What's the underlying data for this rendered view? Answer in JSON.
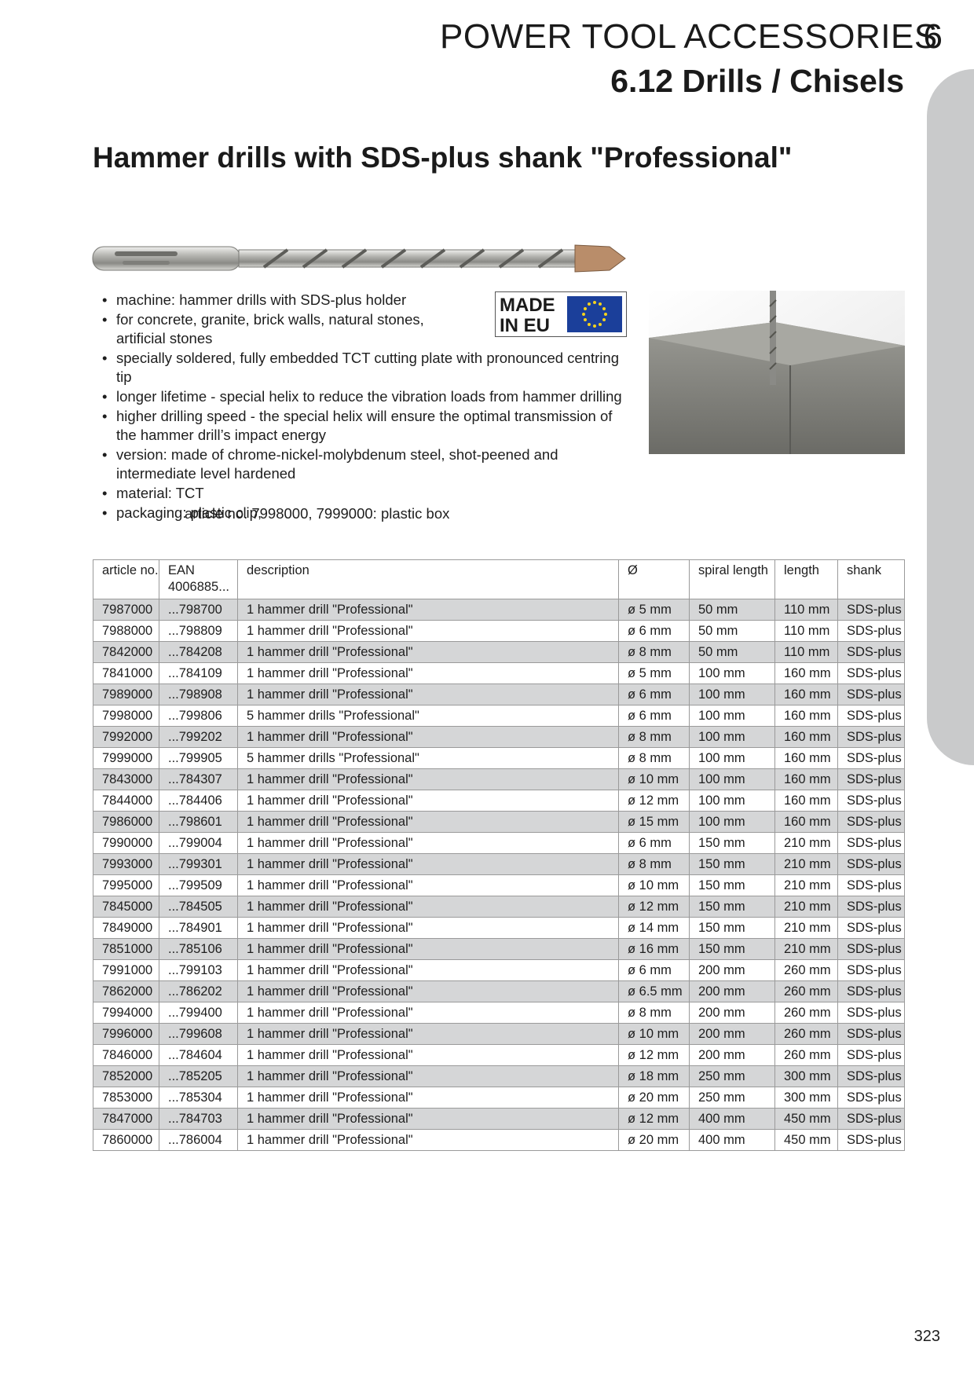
{
  "header": {
    "section_title": "POWER TOOL ACCESSORIES",
    "chapter_number": "6",
    "subsection": "6.12 Drills / Chisels"
  },
  "product": {
    "title": "Hammer drills with SDS-plus shank \"Professional\"",
    "badge": {
      "line1": "MADE",
      "line2": "IN EU"
    },
    "features": [
      "machine: hammer drills with SDS-plus holder",
      "for concrete, granite, brick walls, natural stones, artificial stones",
      "specially soldered, fully embedded TCT cutting plate with pronounced centring tip",
      "longer lifetime - special helix to reduce the vibration loads from hammer drilling",
      "higher drilling speed - the special helix will ensure the optimal transmission of the hammer drill’s impact energy",
      "version: made of chrome-nickel-molybdenum steel, shot-peened and intermediate level hardened",
      "material: TCT",
      "packaging: plastic clip,"
    ],
    "packaging_note": "article no. 7998000, 7999000: plastic box"
  },
  "table": {
    "headers": {
      "article": "article no.",
      "ean_line1": "EAN",
      "ean_line2": "4006885...",
      "description": "description",
      "diameter": "Ø",
      "spiral_length": "spiral length",
      "length": "length",
      "shank": "shank"
    },
    "rows": [
      [
        "7987000",
        "...798700",
        "1 hammer drill \"Professional\"",
        "ø 5 mm",
        "50 mm",
        "110 mm",
        "SDS-plus"
      ],
      [
        "7988000",
        "...798809",
        "1 hammer drill \"Professional\"",
        "ø 6 mm",
        "50 mm",
        "110 mm",
        "SDS-plus"
      ],
      [
        "7842000",
        "...784208",
        "1 hammer drill \"Professional\"",
        "ø 8 mm",
        "50 mm",
        "110 mm",
        "SDS-plus"
      ],
      [
        "7841000",
        "...784109",
        "1 hammer drill \"Professional\"",
        "ø 5 mm",
        "100 mm",
        "160 mm",
        "SDS-plus"
      ],
      [
        "7989000",
        "...798908",
        "1 hammer drill \"Professional\"",
        "ø 6 mm",
        "100 mm",
        "160 mm",
        "SDS-plus"
      ],
      [
        "7998000",
        "...799806",
        "5 hammer drills \"Professional\"",
        "ø 6 mm",
        "100 mm",
        "160 mm",
        "SDS-plus"
      ],
      [
        "7992000",
        "...799202",
        "1 hammer drill \"Professional\"",
        "ø 8 mm",
        "100 mm",
        "160 mm",
        "SDS-plus"
      ],
      [
        "7999000",
        "...799905",
        "5 hammer drills \"Professional\"",
        "ø 8 mm",
        "100 mm",
        "160 mm",
        "SDS-plus"
      ],
      [
        "7843000",
        "...784307",
        "1 hammer drill \"Professional\"",
        "ø 10 mm",
        "100 mm",
        "160 mm",
        "SDS-plus"
      ],
      [
        "7844000",
        "...784406",
        "1 hammer drill \"Professional\"",
        "ø 12 mm",
        "100 mm",
        "160 mm",
        "SDS-plus"
      ],
      [
        "7986000",
        "...798601",
        "1 hammer drill \"Professional\"",
        "ø 15 mm",
        "100 mm",
        "160 mm",
        "SDS-plus"
      ],
      [
        "7990000",
        "...799004",
        "1 hammer drill \"Professional\"",
        "ø 6 mm",
        "150 mm",
        "210 mm",
        "SDS-plus"
      ],
      [
        "7993000",
        "...799301",
        "1 hammer drill \"Professional\"",
        "ø 8 mm",
        "150 mm",
        "210 mm",
        "SDS-plus"
      ],
      [
        "7995000",
        "...799509",
        "1 hammer drill \"Professional\"",
        "ø 10 mm",
        "150 mm",
        "210 mm",
        "SDS-plus"
      ],
      [
        "7845000",
        "...784505",
        "1 hammer drill \"Professional\"",
        "ø 12 mm",
        "150 mm",
        "210 mm",
        "SDS-plus"
      ],
      [
        "7849000",
        "...784901",
        "1 hammer drill \"Professional\"",
        "ø 14 mm",
        "150 mm",
        "210 mm",
        "SDS-plus"
      ],
      [
        "7851000",
        "...785106",
        "1 hammer drill \"Professional\"",
        "ø 16 mm",
        "150 mm",
        "210 mm",
        "SDS-plus"
      ],
      [
        "7991000",
        "...799103",
        "1 hammer drill \"Professional\"",
        "ø 6 mm",
        "200 mm",
        "260 mm",
        "SDS-plus"
      ],
      [
        "7862000",
        "...786202",
        "1 hammer drill \"Professional\"",
        "ø 6.5 mm",
        "200 mm",
        "260 mm",
        "SDS-plus"
      ],
      [
        "7994000",
        "...799400",
        "1 hammer drill \"Professional\"",
        "ø 8 mm",
        "200 mm",
        "260 mm",
        "SDS-plus"
      ],
      [
        "7996000",
        "...799608",
        "1 hammer drill \"Professional\"",
        "ø 10 mm",
        "200 mm",
        "260 mm",
        "SDS-plus"
      ],
      [
        "7846000",
        "...784604",
        "1 hammer drill \"Professional\"",
        "ø 12 mm",
        "200 mm",
        "260 mm",
        "SDS-plus"
      ],
      [
        "7852000",
        "...785205",
        "1 hammer drill \"Professional\"",
        "ø 18 mm",
        "250 mm",
        "300 mm",
        "SDS-plus"
      ],
      [
        "7853000",
        "...785304",
        "1 hammer drill \"Professional\"",
        "ø 20 mm",
        "250 mm",
        "300 mm",
        "SDS-plus"
      ],
      [
        "7847000",
        "...784703",
        "1 hammer drill \"Professional\"",
        "ø 12 mm",
        "400 mm",
        "450 mm",
        "SDS-plus"
      ],
      [
        "7860000",
        "...786004",
        "1 hammer drill \"Professional\"",
        "ø 20 mm",
        "400 mm",
        "450 mm",
        "SDS-plus"
      ]
    ]
  },
  "page_number": "323",
  "colors": {
    "text": "#1e1e1e",
    "tab_strip": "#c9cacb",
    "row_shade": "#d5d6d7",
    "table_border": "#9a9a9a",
    "eu_blue": "#1b3f9a",
    "eu_star": "#f5d21c"
  }
}
